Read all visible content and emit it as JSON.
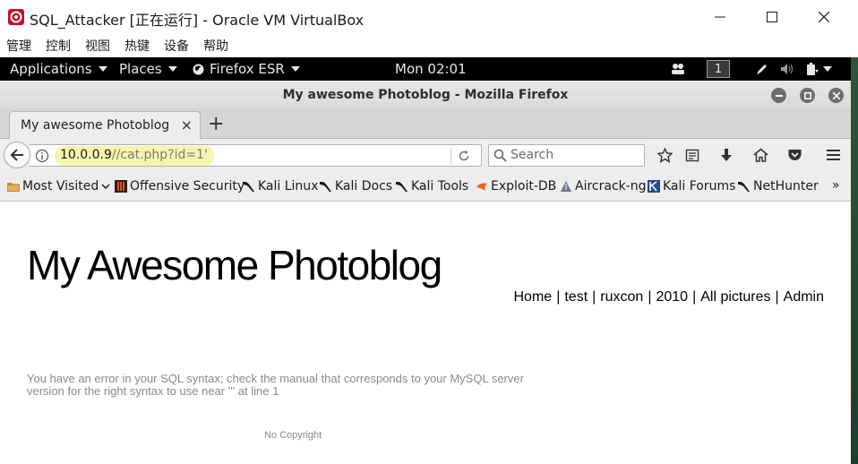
{
  "host": {
    "title": "SQL_Attacker [正在运行] - Oracle VM VirtualBox",
    "menu": [
      "管理",
      "控制",
      "视图",
      "热键",
      "设备",
      "帮助"
    ]
  },
  "panel": {
    "applications": "Applications",
    "places": "Places",
    "firefox": "Firefox ESR",
    "clock": "Mon 02:01",
    "workspace": "1"
  },
  "firefox": {
    "window_title": "My awesome Photoblog - Mozilla Firefox",
    "tab_label": "My awesome Photoblog",
    "url_host": "10.0.0.9",
    "url_path": "//cat.php?id=1'",
    "search_placeholder": "Search",
    "bookmarks": [
      "Most Visited",
      "Offensive Security",
      "Kali Linux",
      "Kali Docs",
      "Kali Tools",
      "Exploit-DB",
      "Aircrack-ng",
      "Kali Forums",
      "NetHunter"
    ],
    "overflow": "»"
  },
  "page": {
    "title": "My Awesome Photoblog",
    "nav": [
      "Home",
      "test",
      "ruxcon",
      "2010",
      "All pictures",
      "Admin"
    ],
    "nav_sep": "|",
    "error": "You have an error in your SQL syntax; check the manual that corresponds to your MySQL server version for the right syntax to use near ''' at line 1",
    "footer": "No Copyright"
  },
  "colors": {
    "url_highlight": "#f6f2a0",
    "panel_bg": "#000000",
    "error_text": "#8a8a8a"
  }
}
